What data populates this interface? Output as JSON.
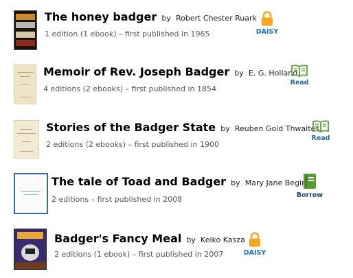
{
  "colors": {
    "lock": "#f5a623",
    "read_icon": "#6aa84f",
    "borrow_icon": "#5c9a36",
    "daisy_label": "#1a6fc0",
    "read_label": "#2a6aa6",
    "borrow_label": "#1f4a7a"
  },
  "results": [
    {
      "title": "The honey badger",
      "by_prefix": "by",
      "author": "Robert Chester Ruark",
      "meta": "1 edition (1 ebook) – first published in 1965",
      "action_label": "DAISY",
      "action_icon": "lock-icon"
    },
    {
      "title": "Memoir of Rev. Joseph Badger",
      "by_prefix": "by",
      "author": "E. G. Holland",
      "meta": "4 editions (2 ebooks) – first published in 1854",
      "action_label": "Read",
      "action_icon": "open-book-icon"
    },
    {
      "title": "Stories of the Badger State",
      "by_prefix": "by",
      "author": "Reuben Gold Thwaites",
      "meta": "2 editions (2 ebooks) – first published in 1900",
      "action_label": "Read",
      "action_icon": "open-book-icon"
    },
    {
      "title": "The tale of Toad and Badger",
      "by_prefix": "by",
      "author": "Mary Jane Begin",
      "meta": "2 editions – first published in 2008",
      "action_label": "Borrow",
      "action_icon": "closed-book-icon"
    },
    {
      "title": "Badger's Fancy Meal",
      "by_prefix": "by",
      "author": "Keiko Kasza",
      "meta": "2 editions (1 ebook) – first published in 2007",
      "action_label": "DAISY",
      "action_icon": "lock-icon"
    }
  ]
}
